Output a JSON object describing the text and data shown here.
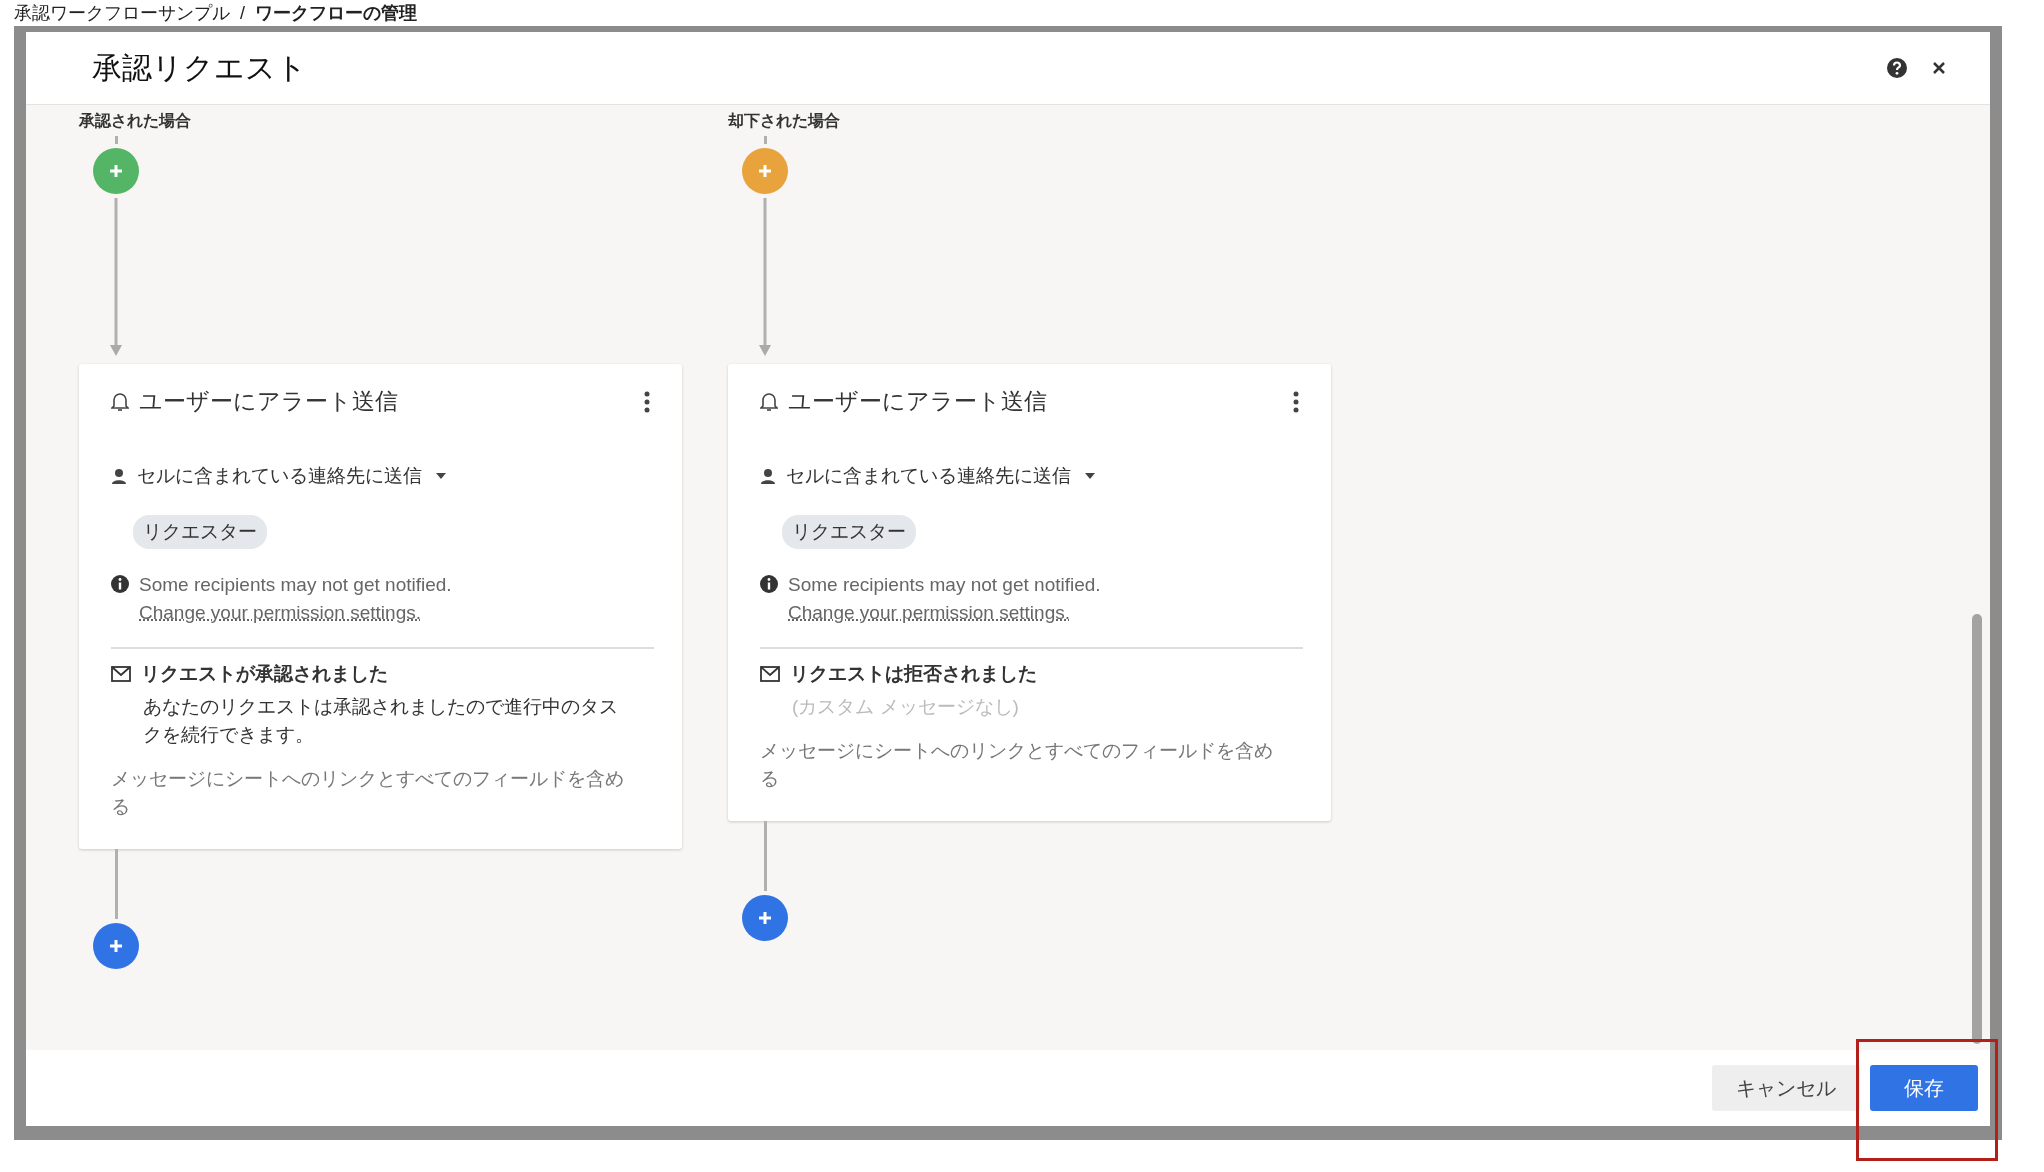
{
  "app_bar": {
    "breadcrumb": [
      "承認ワークフローサンプル",
      "/",
      "ワークフローの管理"
    ]
  },
  "dialog": {
    "title": "承認リクエスト"
  },
  "branches": [
    {
      "label": "承認された場合",
      "color": "#55b567",
      "card": {
        "title": "ユーザーにアラート送信",
        "recipient_mode": "セルに含まれている連絡先に送信",
        "chip": "リクエスター",
        "notice": "Some recipients may not get notified.",
        "notice_link": "Change your permission settings.",
        "subject": "リクエストが承認されました",
        "message": {
          "kind": "custom",
          "text": "あなたのリクエストは承認されましたので進行中のタスクを続行できます。"
        },
        "include_note": "メッセージにシートへのリンクとすべてのフィールドを含める"
      }
    },
    {
      "label": "却下された場合",
      "color": "#e8a33d",
      "card": {
        "title": "ユーザーにアラート送信",
        "recipient_mode": "セルに含まれている連絡先に送信",
        "chip": "リクエスター",
        "notice": "Some recipients may not get notified.",
        "notice_link": "Change your permission settings.",
        "subject": "リクエストは拒否されました",
        "message": {
          "kind": "none",
          "text": "(カスタム メッセージなし)"
        },
        "include_note": "メッセージにシートへのリンクとすべてのフィールドを含める"
      }
    }
  ],
  "footer": {
    "cancel": "キャンセル",
    "save": {
      "label": "保存",
      "highlighted": true
    }
  }
}
